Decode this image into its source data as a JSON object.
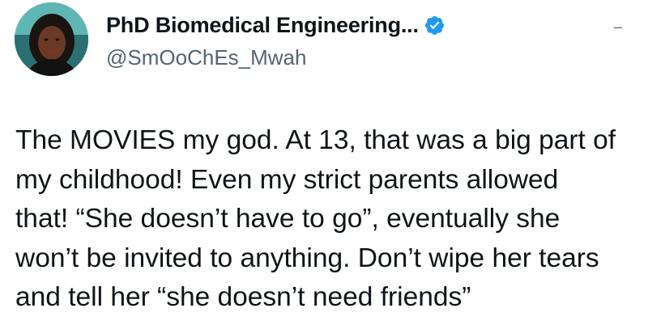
{
  "tweet": {
    "display_name": "PhD Biomedical Engineering...",
    "handle": "@SmOoChEs_Mwah",
    "verified": true,
    "text": "The MOVIES my god. At 13, that was a big part of\nmy childhood! Even my strict parents allowed\nthat! “She doesn’t have to go”, eventually she\nwon’t be invited to anything. Don’t wipe her tears\nand tell her “she doesn’t need friends”",
    "more_icon": "more-icon"
  },
  "colors": {
    "text": "#0f1419",
    "secondary": "#536471",
    "verified_blue": "#1d9bf0"
  }
}
